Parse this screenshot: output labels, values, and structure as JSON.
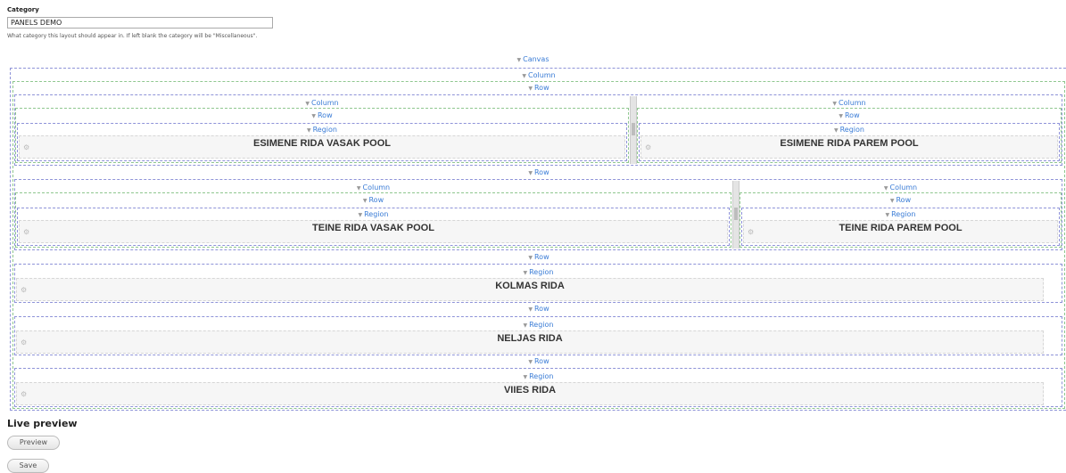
{
  "category": {
    "label": "Category",
    "value": "PANELS DEMO",
    "description": "What category this layout should appear in. If left blank the category will be \"Miscellaneous\"."
  },
  "layout": {
    "canvas_label": "Canvas",
    "column_label": "Column",
    "row_label": "Row",
    "region_label": "Region",
    "regions": {
      "r1_left": "ESIMENE RIDA VASAK POOL",
      "r1_right": "ESIMENE RIDA PAREM POOL",
      "r2_left": "TEINE RIDA VASAK POOL",
      "r2_right": "TEINE RIDA PAREM POOL",
      "r3": "KOLMAS RIDA",
      "r4": "NELJAS RIDA",
      "r5": "VIIES RIDA"
    },
    "colors": {
      "label": "#3a7cd6",
      "blue_border": "#8e93d8",
      "green_border": "#8fc78f"
    }
  },
  "live_preview": {
    "title": "Live preview",
    "preview_button": "Preview",
    "save_button": "Save"
  }
}
